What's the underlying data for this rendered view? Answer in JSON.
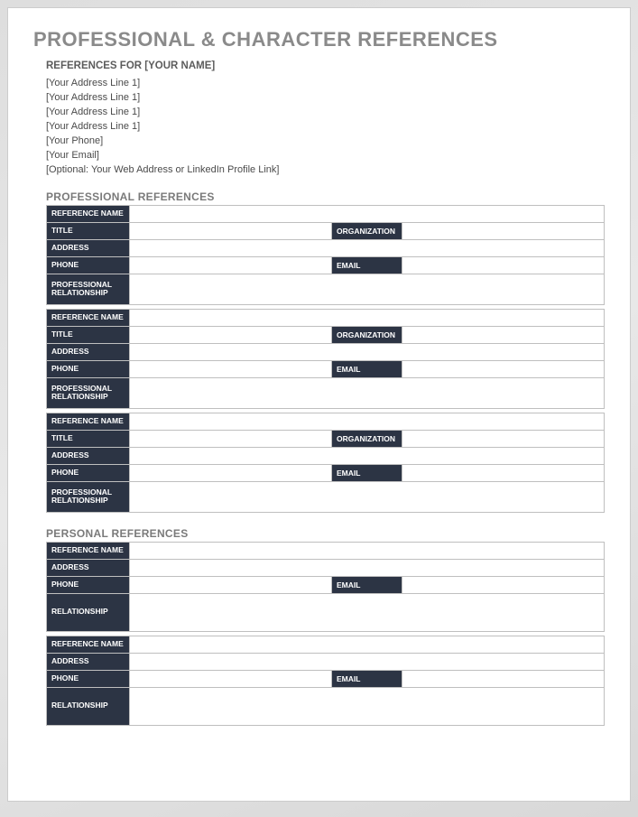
{
  "title": "PROFESSIONAL & CHARACTER REFERENCES",
  "references_for": "REFERENCES FOR [YOUR NAME]",
  "info_lines": [
    "[Your Address Line 1]",
    "[Your Address Line 1]",
    "[Your Address Line 1]",
    "[Your Address Line 1]",
    "[Your Phone]",
    "[Your Email]",
    "[Optional: Your Web Address or LinkedIn Profile Link]"
  ],
  "sections": {
    "professional": {
      "heading": "PROFESSIONAL REFERENCES",
      "labels": {
        "reference_name": "REFERENCE NAME",
        "title": "TITLE",
        "organization": "ORGANIZATION",
        "address": "ADDRESS",
        "phone": "PHONE",
        "email": "EMAIL",
        "relationship": "PROFESSIONAL RELATIONSHIP"
      },
      "entries": [
        {
          "reference_name": "",
          "title": "",
          "organization": "",
          "address": "",
          "phone": "",
          "email": "",
          "relationship": ""
        },
        {
          "reference_name": "",
          "title": "",
          "organization": "",
          "address": "",
          "phone": "",
          "email": "",
          "relationship": ""
        },
        {
          "reference_name": "",
          "title": "",
          "organization": "",
          "address": "",
          "phone": "",
          "email": "",
          "relationship": ""
        }
      ]
    },
    "personal": {
      "heading": "PERSONAL REFERENCES",
      "labels": {
        "reference_name": "REFERENCE NAME",
        "address": "ADDRESS",
        "phone": "PHONE",
        "email": "EMAIL",
        "relationship": "RELATIONSHIP"
      },
      "entries": [
        {
          "reference_name": "",
          "address": "",
          "phone": "",
          "email": "",
          "relationship": ""
        },
        {
          "reference_name": "",
          "address": "",
          "phone": "",
          "email": "",
          "relationship": ""
        }
      ]
    }
  }
}
